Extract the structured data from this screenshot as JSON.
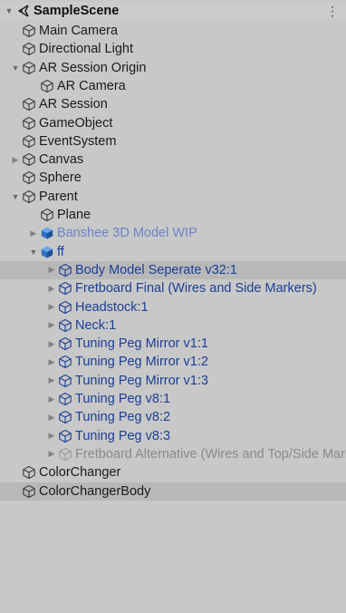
{
  "hierarchy": {
    "scene": {
      "name": "SampleScene",
      "menu_glyph": "⋮"
    },
    "items": [
      {
        "label": "Main Camera",
        "style": "normal"
      },
      {
        "label": "Directional Light",
        "style": "normal"
      },
      {
        "label": "AR Session Origin",
        "style": "normal",
        "expanded": true
      },
      {
        "label": "AR Camera",
        "style": "normal"
      },
      {
        "label": "AR Session",
        "style": "normal"
      },
      {
        "label": "GameObject",
        "style": "normal"
      },
      {
        "label": "EventSystem",
        "style": "normal"
      },
      {
        "label": "Canvas",
        "style": "normal",
        "expanded": false
      },
      {
        "label": "Sphere",
        "style": "normal"
      },
      {
        "label": "Parent",
        "style": "normal",
        "expanded": true
      },
      {
        "label": "Plane",
        "style": "normal"
      },
      {
        "label": "Banshee 3D Model WIP",
        "style": "prefab-light",
        "expanded": false
      },
      {
        "label": "ff",
        "style": "prefab",
        "expanded": true
      },
      {
        "label": "Body Model Seperate v32:1",
        "style": "prefab",
        "expanded": false,
        "selected": true
      },
      {
        "label": "Fretboard Final (Wires and Side Markers)",
        "style": "prefab",
        "expanded": false
      },
      {
        "label": "Headstock:1",
        "style": "prefab",
        "expanded": false
      },
      {
        "label": "Neck:1",
        "style": "prefab",
        "expanded": false
      },
      {
        "label": "Tuning Peg Mirror v1:1",
        "style": "prefab",
        "expanded": false
      },
      {
        "label": "Tuning Peg Mirror v1:2",
        "style": "prefab",
        "expanded": false
      },
      {
        "label": "Tuning Peg Mirror v1:3",
        "style": "prefab",
        "expanded": false
      },
      {
        "label": "Tuning Peg v8:1",
        "style": "prefab",
        "expanded": false
      },
      {
        "label": "Tuning Peg v8:2",
        "style": "prefab",
        "expanded": false
      },
      {
        "label": "Tuning Peg v8:3",
        "style": "prefab",
        "expanded": false
      },
      {
        "label": "Fretboard Alternative (Wires and Top/Side Markers)",
        "style": "disabled",
        "expanded": false
      },
      {
        "label": "ColorChanger",
        "style": "normal"
      },
      {
        "label": "ColorChangerBody",
        "style": "normal",
        "selected": true
      }
    ]
  },
  "colors": {
    "prefab_blue": "#1a3f94",
    "prefab_light": "#6a84c6",
    "disabled_gray": "#8a8a8a",
    "selection": "#b8b8b8",
    "background": "#c8c8c8"
  }
}
